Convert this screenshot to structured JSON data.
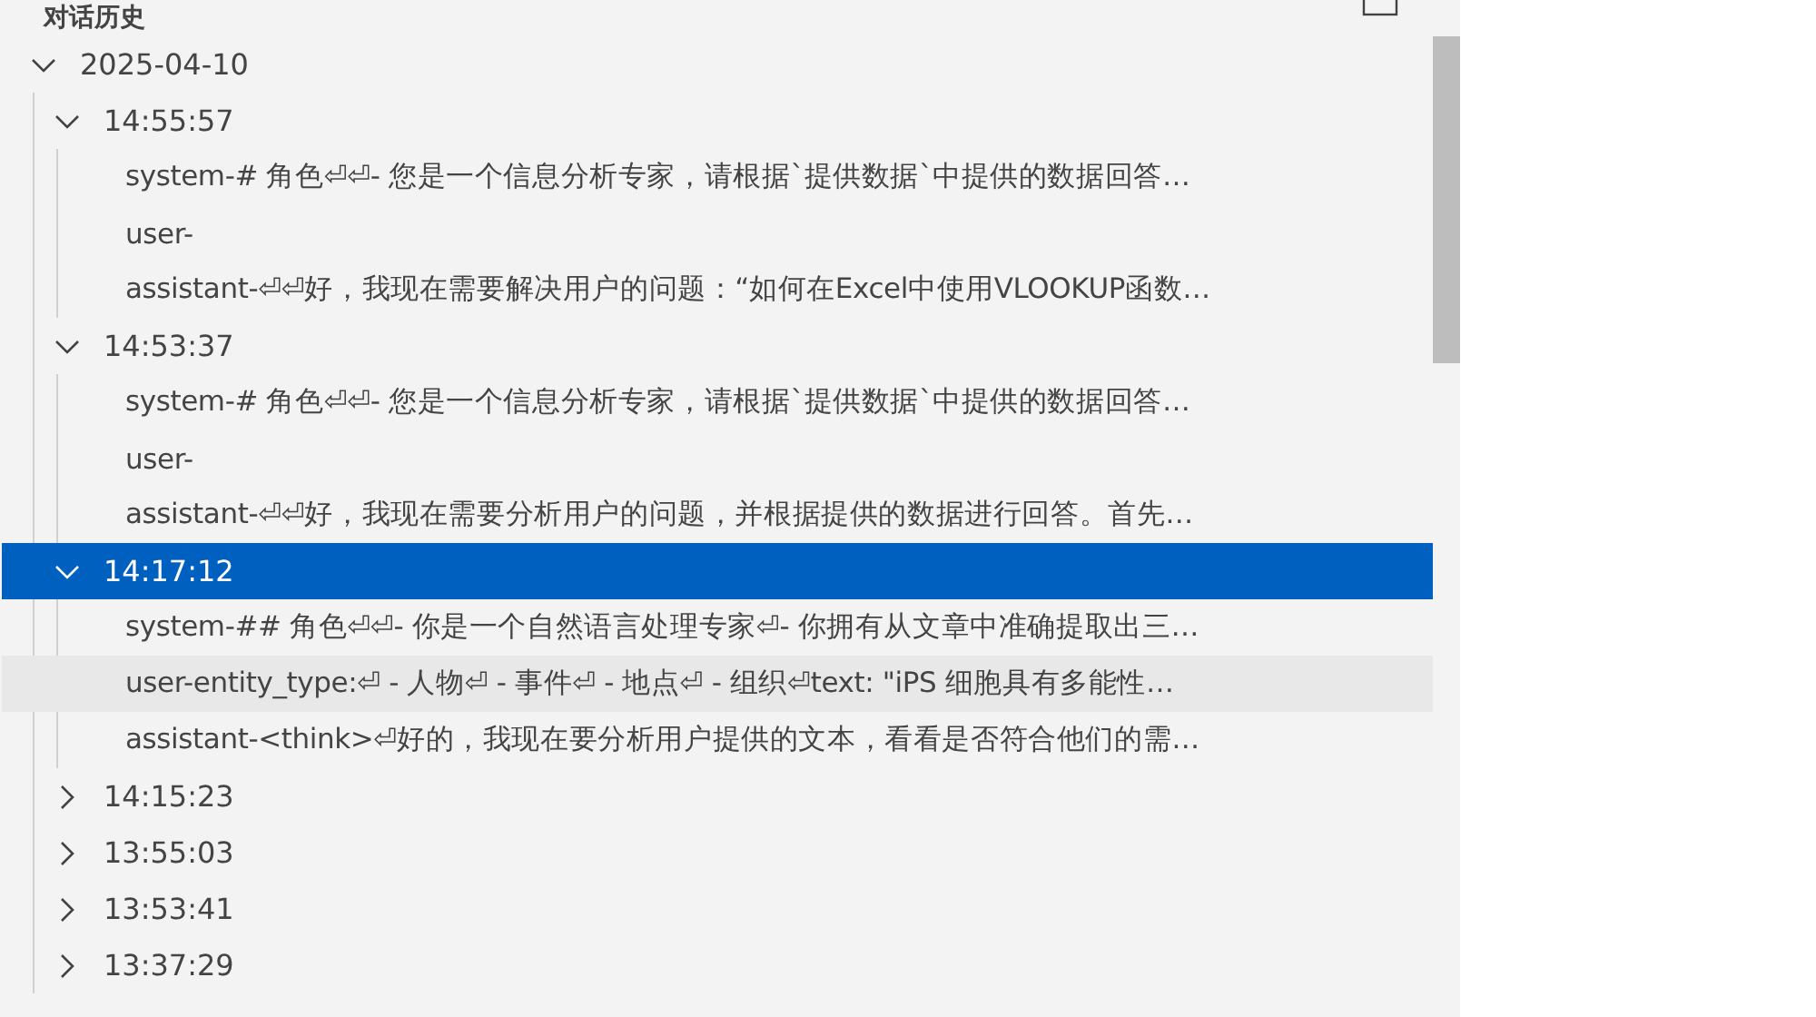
{
  "panel": {
    "title": "对话历史"
  },
  "tree": [
    {
      "label": "2025-04-10",
      "expanded": true,
      "children": [
        {
          "label": "14:55:57",
          "expanded": true,
          "selected": false,
          "messages": [
            {
              "text": "system-# 角色⏎⏎- 您是一个信息分析专家，请根据`提供数据`中提供的数据回答…",
              "hovered": false
            },
            {
              "text": "user-",
              "hovered": false
            },
            {
              "text": "assistant-⏎⏎好，我现在需要解决用户的问题：“如何在Excel中使用VLOOKUP函数…",
              "hovered": false
            }
          ]
        },
        {
          "label": "14:53:37",
          "expanded": true,
          "selected": false,
          "messages": [
            {
              "text": "system-# 角色⏎⏎- 您是一个信息分析专家，请根据`提供数据`中提供的数据回答…",
              "hovered": false
            },
            {
              "text": "user-",
              "hovered": false
            },
            {
              "text": "assistant-⏎⏎好，我现在需要分析用户的问题，并根据提供的数据进行回答。首先…",
              "hovered": false
            }
          ]
        },
        {
          "label": "14:17:12",
          "expanded": true,
          "selected": true,
          "messages": [
            {
              "text": "system-## 角色⏎⏎- 你是一个自然语言处理专家⏎- 你拥有从文章中准确提取出三…",
              "hovered": false
            },
            {
              "text": "user-entity_type:⏎  - 人物⏎  - 事件⏎  - 地点⏎  - 组织⏎text: \"iPS 细胞具有多能性…",
              "hovered": true
            },
            {
              "text": "assistant-<think>⏎好的，我现在要分析用户提供的文本，看看是否符合他们的需…",
              "hovered": false
            }
          ]
        },
        {
          "label": "14:15:23",
          "expanded": false,
          "selected": false
        },
        {
          "label": "13:55:03",
          "expanded": false,
          "selected": false
        },
        {
          "label": "13:53:41",
          "expanded": false,
          "selected": false
        },
        {
          "label": "13:37:29",
          "expanded": false,
          "selected": false
        }
      ]
    }
  ]
}
